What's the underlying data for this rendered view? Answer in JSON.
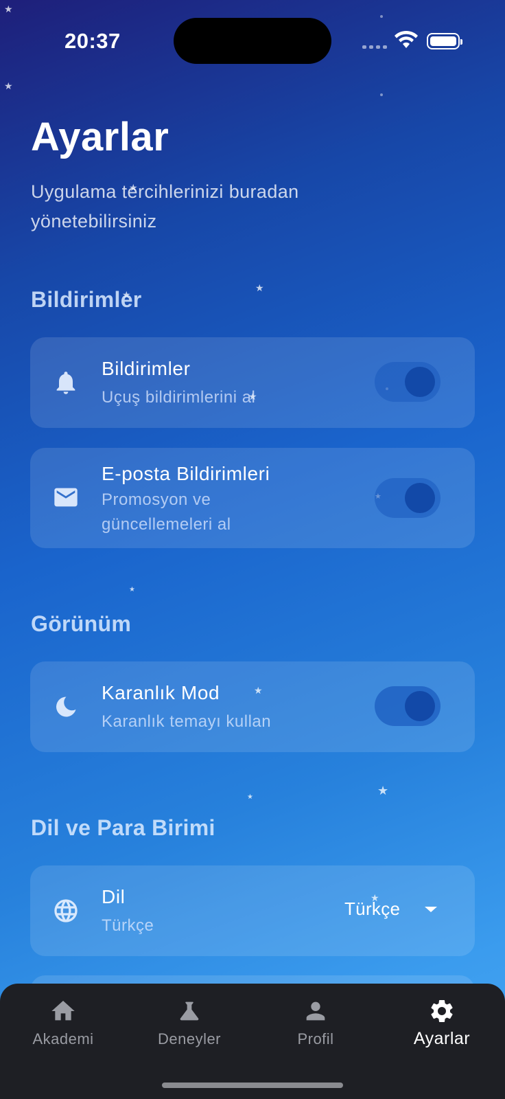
{
  "status_bar": {
    "time": "20:37",
    "wifi_icon": "wifi-icon",
    "battery_icon": "battery-icon"
  },
  "page": {
    "title": "Ayarlar",
    "subtitle": "Uygulama tercihlerinizi buradan yönetebilirsiniz"
  },
  "sections": {
    "notifications": {
      "title": "Bildirimler",
      "items": [
        {
          "icon": "bell-icon",
          "title": "Bildirimler",
          "subtitle": "Uçuş bildirimlerini al",
          "enabled": true
        },
        {
          "icon": "mail-icon",
          "title": "E-posta Bildirimleri",
          "subtitle": "Promosyon ve güncellemeleri al",
          "enabled": true
        }
      ]
    },
    "appearance": {
      "title": "Görünüm",
      "items": [
        {
          "icon": "moon-icon",
          "title": "Karanlık Mod",
          "subtitle": "Karanlık temayı kullan",
          "enabled": true
        }
      ]
    },
    "language_currency": {
      "title": "Dil ve Para Birimi",
      "items": [
        {
          "icon": "globe-icon",
          "title": "Dil",
          "subtitle": "Türkçe",
          "selected_value": "Türkçe"
        }
      ]
    }
  },
  "bottom_nav": {
    "items": [
      {
        "icon": "home-icon",
        "label": "Akademi",
        "active": false
      },
      {
        "icon": "flask-icon",
        "label": "Deneyler",
        "active": false
      },
      {
        "icon": "person-icon",
        "label": "Profil",
        "active": false
      },
      {
        "icon": "gear-icon",
        "label": "Ayarlar",
        "active": true
      }
    ]
  },
  "colors": {
    "gradient_top": "#1e1f7a",
    "gradient_bottom": "#47a6f3",
    "nav_background": "#1e1f24",
    "toggle_knob": "#1249a8"
  }
}
